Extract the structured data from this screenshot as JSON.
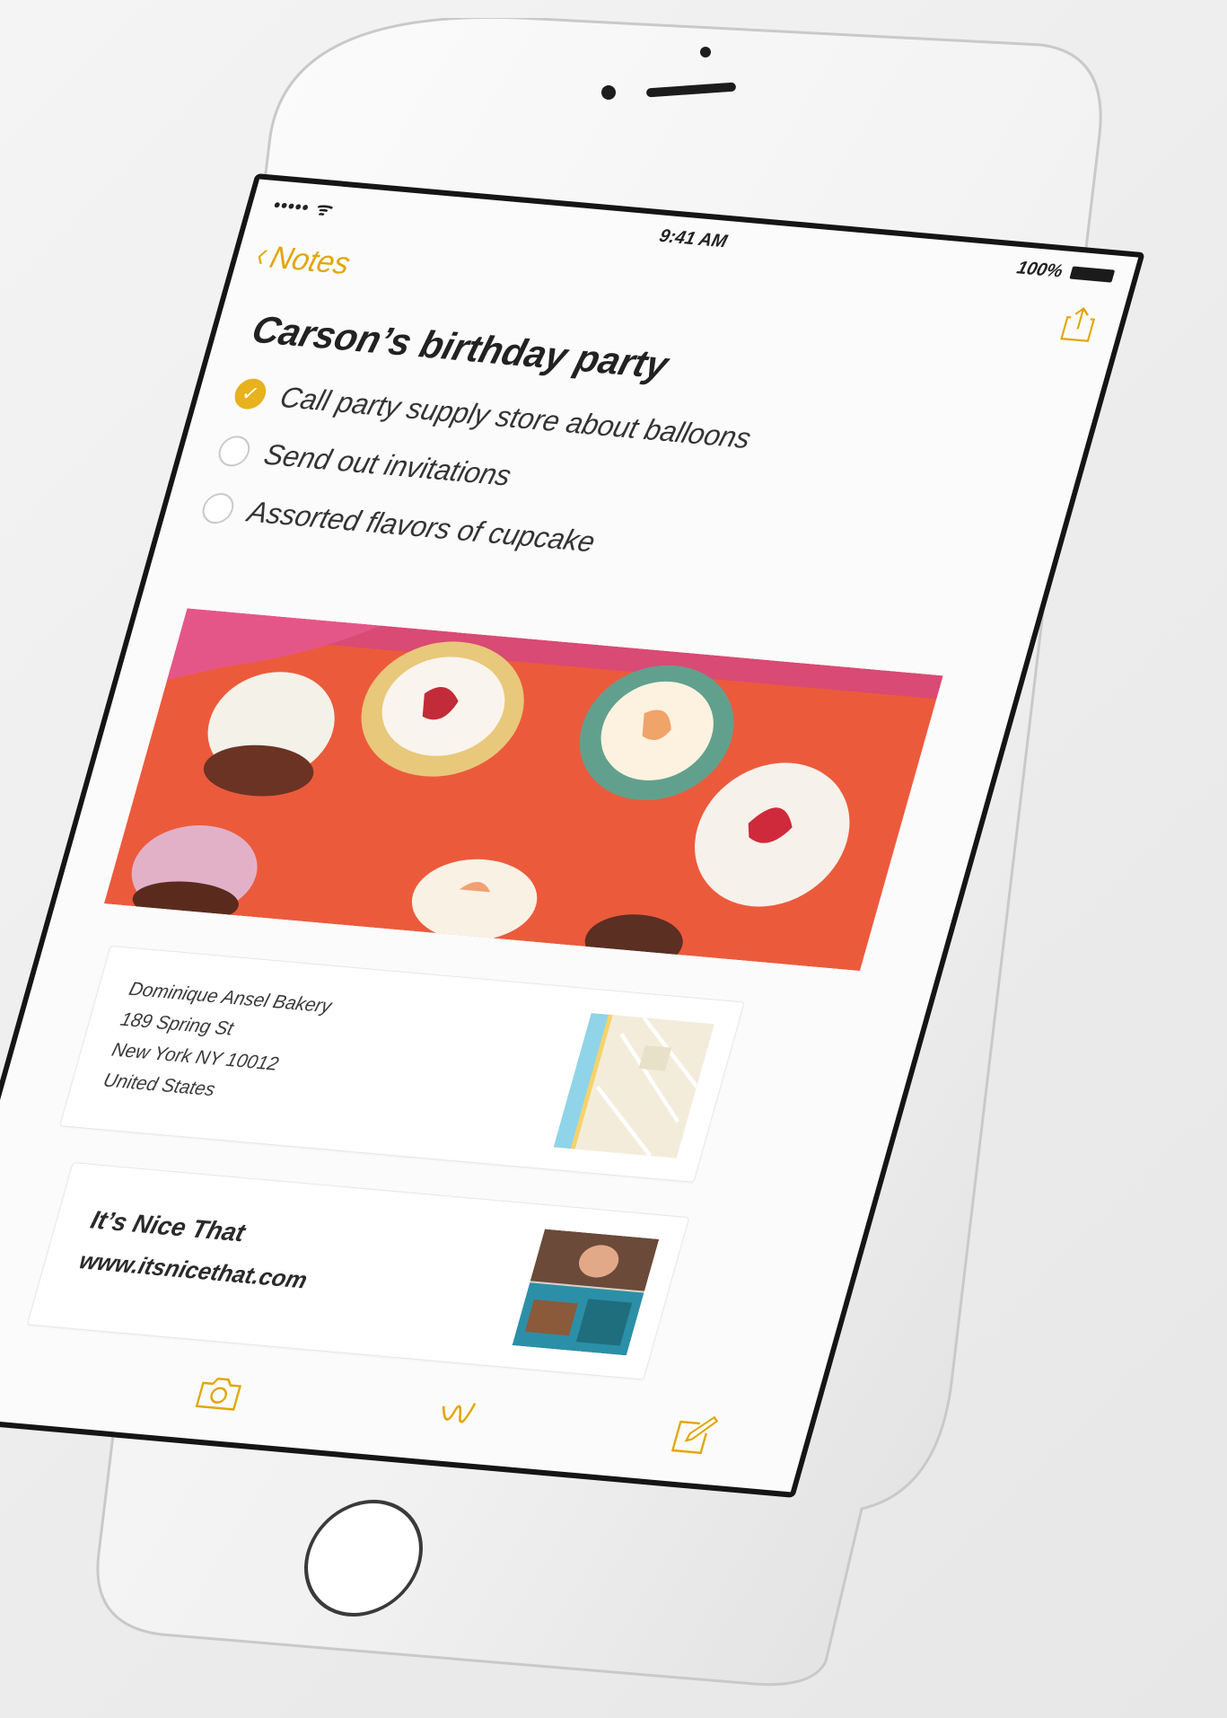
{
  "status_bar": {
    "carrier": "••••• ᯤ",
    "time": "9:41 AM",
    "battery": "100%"
  },
  "nav": {
    "back_label": "Notes",
    "share_icon": "share-icon"
  },
  "note": {
    "title": "Carson’s birthday party",
    "checklist": [
      {
        "label": "Call party supply store about balloons",
        "checked": true
      },
      {
        "label": "Send out invitations",
        "checked": false
      },
      {
        "label": "Assorted flavors of cupcake",
        "checked": false
      }
    ],
    "location_card": {
      "line1": "Dominique Ansel Bakery",
      "line2": "189 Spring St",
      "line3": "New York NY 10012",
      "line4": "United States"
    },
    "link_card": {
      "title": "It’s Nice That",
      "url": "www.itsnicethat.com"
    }
  },
  "toolbar": {
    "items": [
      "trash-icon",
      "camera-icon",
      "sketch-icon",
      "compose-icon"
    ]
  },
  "colors": {
    "accent": "#e2a600",
    "background": "#fbfbfb"
  }
}
